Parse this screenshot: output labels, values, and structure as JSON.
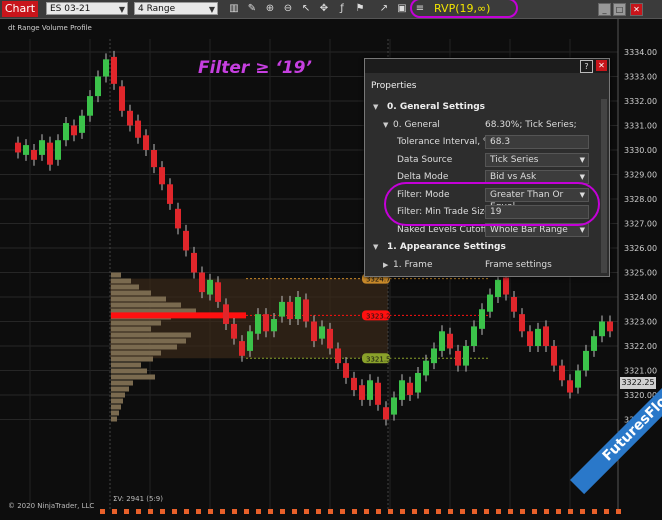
{
  "toolbar": {
    "tab": "Chart",
    "instrument": "ES 03-21",
    "period": "4 Range",
    "indicator": "RVP(19,∞)"
  },
  "chart": {
    "title": "dt Range Volume Profile",
    "copyright": "© 2020 NinjaTrader, LLC",
    "annotation": "Filter ≥ ‘19’",
    "sum_volume": "ΣV: 2941 (5:9)",
    "current_price": "3322.25",
    "y_ticks": [
      "3334.00",
      "3333.00",
      "3332.00",
      "3331.00",
      "3330.00",
      "3329.00",
      "3328.00",
      "3327.00",
      "3326.00",
      "3325.00",
      "3324.00",
      "3323.00",
      "3322.00",
      "3321.00",
      "3320.00",
      "3319.00"
    ],
    "levels": {
      "high": "3324.75",
      "poc": "3323.25",
      "low": "3321.50"
    },
    "colors": {
      "up": "#3bc24a",
      "down": "#e0262b",
      "poc": "#ff1010",
      "profile": "#7a6a4f",
      "area": "#3a2a1a"
    }
  },
  "properties": {
    "title": "Properties",
    "rows": [
      {
        "type": "section",
        "label": "0. General Settings"
      },
      {
        "type": "sub",
        "label": "0. General",
        "value": "68.30%; Tick Series; (19, ∞)"
      },
      {
        "type": "input",
        "label": "Tolerance Interval, %",
        "value": "68.3"
      },
      {
        "type": "select",
        "label": "Data Source",
        "value": "Tick Series"
      },
      {
        "type": "select",
        "label": "Delta Mode",
        "value": "Bid vs Ask"
      },
      {
        "type": "select",
        "label": "Filter: Mode",
        "value": "Greater Than Or Equal"
      },
      {
        "type": "input",
        "label": "Filter: Min Trade Size",
        "value": "19"
      },
      {
        "type": "select",
        "label": "Naked Levels Cutoff",
        "value": "Whole Bar Range"
      },
      {
        "type": "section",
        "label": "1. Appearance Settings"
      },
      {
        "type": "sub",
        "label": "1. Frame",
        "value": "Frame settings"
      }
    ]
  },
  "watermark": "FuturesFlow.io"
}
